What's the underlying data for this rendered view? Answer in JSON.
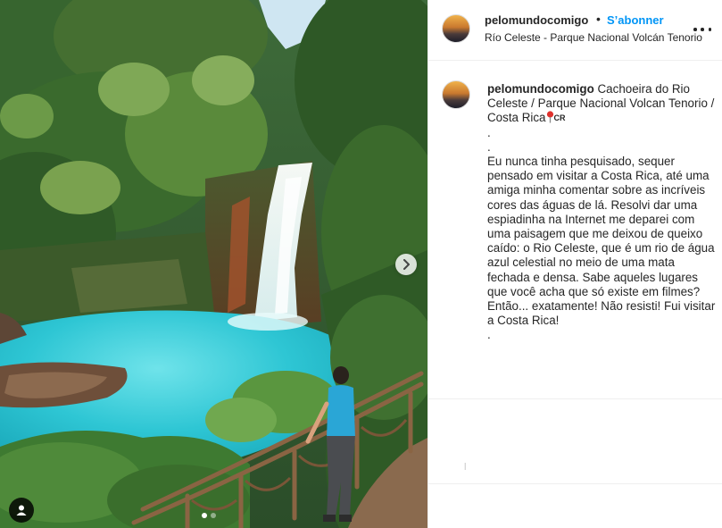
{
  "post": {
    "account": {
      "username": "pelomundocomigo",
      "separator": "•",
      "follow_label": "S’abonner",
      "location": "Río Celeste - Parque Nacional Volcán Tenorio"
    },
    "caption": {
      "username": "pelomundocomigo",
      "title": "Cachoeira do Rio Celeste / Parque Nacional Volcan Tenorio / Costa Rica",
      "flag": "CR",
      "dot1": ".",
      "dot2": ".",
      "body": "Eu nunca tinha pesquisado, sequer pensado em visitar a Costa Rica, até uma amiga minha comentar sobre as incríveis cores das águas de lá. Resolvi dar uma espiadinha na Internet me deparei com uma paisagem que me deixou de queixo caído: o Rio Celeste, que é um rio de água azul celestial no meio de uma mata fechada e densa. Sabe aqueles lugares que você acha que só existe em filmes? Então... exatamente! Não resisti! Fui visitar a Costa Rica!",
      "dot3": "."
    },
    "faded_text": "Ɩ",
    "media": {
      "carousel_count": 2,
      "active_index": 0,
      "icons": {
        "next": "chevron-right-icon",
        "tags": "user-tag-icon"
      }
    }
  },
  "colors": {
    "follow_blue": "#0095f6",
    "text": "#262626",
    "water": "#2ec6d4"
  }
}
